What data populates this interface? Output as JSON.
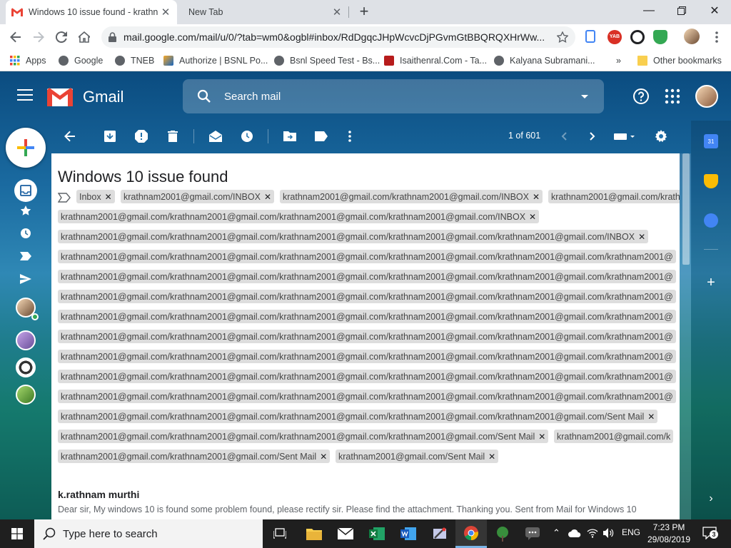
{
  "browser": {
    "tabs": [
      {
        "title": "Windows 10 issue found - krathn",
        "active": true
      },
      {
        "title": "New Tab",
        "active": false
      }
    ],
    "url": "mail.google.com/mail/u/0/?tab=wm0&ogbl#inbox/RdDgqcJHpWcvcDjPGvmGtBBQRQXHrWw...",
    "bookmarks": [
      {
        "label": "Apps",
        "icon": "apps-grid-icon"
      },
      {
        "label": "Google",
        "icon": "globe-icon"
      },
      {
        "label": "TNEB",
        "icon": "globe-icon"
      },
      {
        "label": "Authorize | BSNL Po...",
        "icon": "bsnl-icon"
      },
      {
        "label": "Bsnl Speed Test - Bs...",
        "icon": "globe-icon"
      },
      {
        "label": "Isaithenral.Com - Ta...",
        "icon": "isai-icon"
      },
      {
        "label": "Kalyana Subramani...",
        "icon": "globe-icon"
      }
    ],
    "bookmarks_overflow": "»",
    "other_bookmarks": "Other bookmarks"
  },
  "gmail": {
    "wordmark": "Gmail",
    "search_placeholder": "Search mail",
    "pager": "1 of 601",
    "subject": "Windows 10 issue found",
    "labels": [
      [
        "Inbox",
        "krathnam2001@gmail.com/INBOX",
        "krathnam2001@gmail.com/krathnam2001@gmail.com/INBOX",
        "krathnam2001@gmail.com/krath"
      ],
      [
        "krathnam2001@gmail.com/krathnam2001@gmail.com/krathnam2001@gmail.com/krathnam2001@gmail.com/INBOX"
      ],
      [
        "krathnam2001@gmail.com/krathnam2001@gmail.com/krathnam2001@gmail.com/krathnam2001@gmail.com/krathnam2001@gmail.com/INBOX"
      ],
      [
        "krathnam2001@gmail.com/krathnam2001@gmail.com/krathnam2001@gmail.com/krathnam2001@gmail.com/krathnam2001@gmail.com/krathnam2001@"
      ],
      [
        "krathnam2001@gmail.com/krathnam2001@gmail.com/krathnam2001@gmail.com/krathnam2001@gmail.com/krathnam2001@gmail.com/krathnam2001@"
      ],
      [
        "krathnam2001@gmail.com/krathnam2001@gmail.com/krathnam2001@gmail.com/krathnam2001@gmail.com/krathnam2001@gmail.com/krathnam2001@"
      ],
      [
        "krathnam2001@gmail.com/krathnam2001@gmail.com/krathnam2001@gmail.com/krathnam2001@gmail.com/krathnam2001@gmail.com/krathnam2001@"
      ],
      [
        "krathnam2001@gmail.com/krathnam2001@gmail.com/krathnam2001@gmail.com/krathnam2001@gmail.com/krathnam2001@gmail.com/krathnam2001@"
      ],
      [
        "krathnam2001@gmail.com/krathnam2001@gmail.com/krathnam2001@gmail.com/krathnam2001@gmail.com/krathnam2001@gmail.com/krathnam2001@"
      ],
      [
        "krathnam2001@gmail.com/krathnam2001@gmail.com/krathnam2001@gmail.com/krathnam2001@gmail.com/krathnam2001@gmail.com/krathnam2001@"
      ],
      [
        "krathnam2001@gmail.com/krathnam2001@gmail.com/krathnam2001@gmail.com/krathnam2001@gmail.com/krathnam2001@gmail.com/krathnam2001@"
      ],
      [
        "krathnam2001@gmail.com/krathnam2001@gmail.com/krathnam2001@gmail.com/krathnam2001@gmail.com/krathnam2001@gmail.com/Sent Mail"
      ],
      [
        "krathnam2001@gmail.com/krathnam2001@gmail.com/krathnam2001@gmail.com/krathnam2001@gmail.com/Sent Mail",
        "krathnam2001@gmail.com/k"
      ],
      [
        "krathnam2001@gmail.com/krathnam2001@gmail.com/Sent Mail",
        "krathnam2001@gmail.com/Sent Mail"
      ]
    ],
    "sender": "k.rathnam murthi",
    "snippet": "Dear sir, My windows 10 is found some problem found, please rectify sir. Please find the attachment. Thanking you. Sent from Mail for Windows 10"
  },
  "taskbar": {
    "search_placeholder": "Type here to search",
    "apps": [
      "task-view-icon",
      "file-explorer-icon",
      "mail-icon",
      "excel-icon",
      "word-icon",
      "tools-icon",
      "chrome-icon",
      "tree-icon",
      "chat-icon"
    ],
    "language": "ENG",
    "time": "7:23 PM",
    "date": "29/08/2019",
    "notification_count": "3"
  },
  "colors": {
    "gmail_red": "#EA4335",
    "chrome_tabstrip": "#dee1e6",
    "taskbar": "#1f1f1f",
    "label_chip": "#dddddd"
  }
}
